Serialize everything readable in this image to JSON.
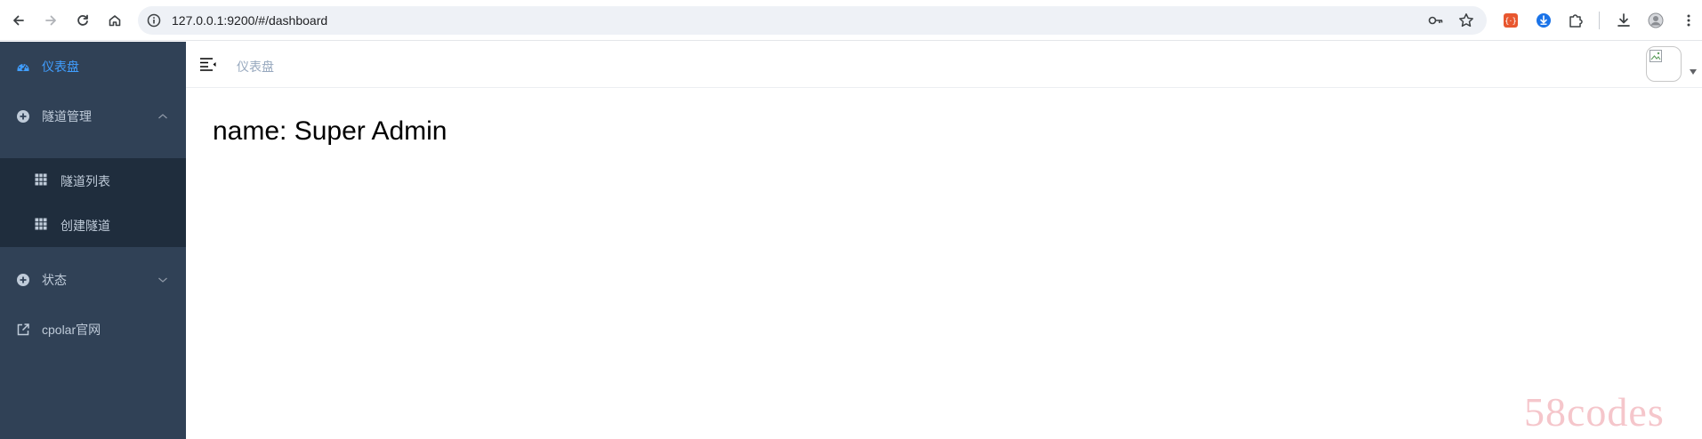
{
  "browser": {
    "url": "127.0.0.1:9200/#/dashboard",
    "icons": [
      "back-icon",
      "forward-icon",
      "reload-icon",
      "home-icon",
      "site-info-icon",
      "password-key-icon",
      "bookmark-star-icon",
      "extension-red-icon",
      "extension-blue-icon",
      "extensions-puzzle-icon",
      "download-icon",
      "profile-icon",
      "more-icon"
    ]
  },
  "sidebar": {
    "items": [
      {
        "label": "仪表盘",
        "icon": "dashboard-icon",
        "active": true
      },
      {
        "label": "隧道管理",
        "icon": "plus-circle-icon",
        "expanded": true,
        "children": [
          {
            "label": "隧道列表",
            "icon": "table-icon"
          },
          {
            "label": "创建隧道",
            "icon": "table-icon"
          }
        ]
      },
      {
        "label": "状态",
        "icon": "plus-circle-icon",
        "expanded": false
      },
      {
        "label": "cpolar官网",
        "icon": "external-link-icon"
      }
    ]
  },
  "navbar": {
    "breadcrumb": "仪表盘"
  },
  "main": {
    "greeting": "name: Super Admin"
  },
  "watermark": "58codes",
  "colors": {
    "sidebar_bg": "#304156",
    "submenu_bg": "#1f2d3d",
    "menu_text": "#bfcbd9",
    "active_text": "#409eff",
    "breadcrumb_text": "#97a8be"
  }
}
